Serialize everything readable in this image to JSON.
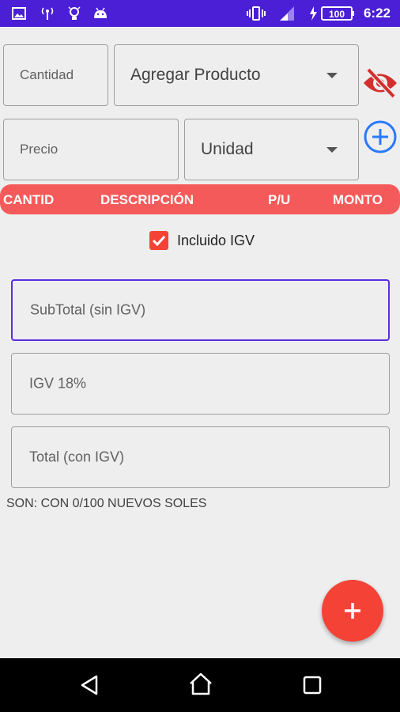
{
  "status_bar": {
    "time": "6:22",
    "battery": "100",
    "icons": [
      "image-icon",
      "broadcast-icon",
      "lightbulb-icon",
      "android-icon",
      "vibrate-icon",
      "signal-icon",
      "battery-charging-icon"
    ]
  },
  "form": {
    "cantidad_placeholder": "Cantidad",
    "producto_value": "Agregar Producto",
    "precio_placeholder": "Precio",
    "unidad_value": "Unidad"
  },
  "table_header": {
    "cantid": "CANTID",
    "descripcion": "DESCRIPCIÓN",
    "pu": "P/U",
    "monto": "MONTO"
  },
  "igv": {
    "checkbox_label": "Incluido IGV",
    "checked": true
  },
  "totals": {
    "subtotal_placeholder": "SubTotal (sin IGV)",
    "igv_placeholder": "IGV 18%",
    "total_placeholder": "Total (con IGV)",
    "son_text": "SON:  CON 0/100 NUEVOS SOLES"
  },
  "colors": {
    "status_bar": "#4b1fd6",
    "accent_red": "#f44336",
    "header_red": "#f55a5a",
    "focus_purple": "#5a2ee0",
    "add_blue": "#2979ff"
  }
}
